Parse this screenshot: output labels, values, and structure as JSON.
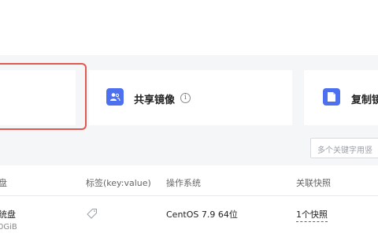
{
  "cards": {
    "shared": {
      "title": "共享镜像",
      "icon": "share-user-icon",
      "info_icon": "info-icon"
    },
    "copy": {
      "title": "复制镜",
      "icon": "document-icon"
    }
  },
  "search": {
    "placeholder": "多个关键字用竖"
  },
  "table": {
    "headers": {
      "disk": "盘",
      "tags": "标签(key:value)",
      "os": "操作系统",
      "snapshots": "关联快照"
    },
    "rows": [
      {
        "disk": "统盘",
        "disk_sub": "0GiB",
        "os": "CentOS 7.9 64位",
        "snapshots": "1个快照"
      }
    ]
  },
  "colors": {
    "accent": "#4d70ee",
    "selected_border": "#e0584e"
  }
}
